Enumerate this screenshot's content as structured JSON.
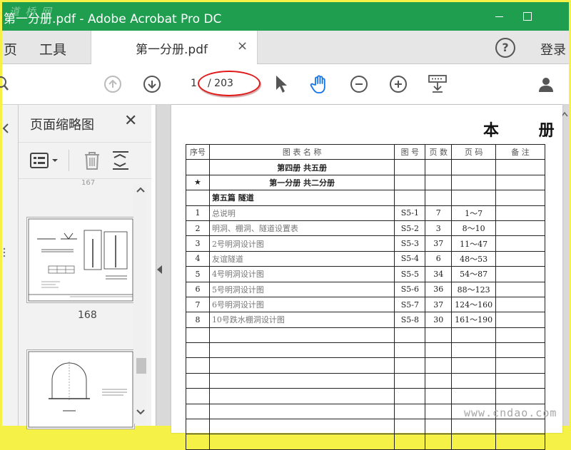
{
  "window": {
    "title": "第一分册.pdf - Adobe Acrobat Pro DC",
    "watermark": "道 桥 网"
  },
  "tabs": {
    "home_label": "页",
    "tools_label": "工具",
    "doc_tab_label": "第一分册.pdf",
    "close_glyph": "×",
    "help_glyph": "?",
    "login_label": "登录"
  },
  "toolbar": {
    "current_page": "1",
    "total_pages": "/ 203"
  },
  "thumbnails": {
    "panel_title": "页面缩略图",
    "close_glyph": "✕",
    "items": [
      {
        "page": "167"
      },
      {
        "page": "168"
      }
    ]
  },
  "document": {
    "title": "本 册",
    "headers": [
      "序号",
      "图 表 名 称",
      "图 号",
      "页 数",
      "页 码",
      "备 注"
    ],
    "rows": [
      {
        "no": "",
        "name": "第四册 共五册",
        "code": "",
        "pages": "",
        "range": ""
      },
      {
        "no": "★",
        "name": "第一分册 共二分册",
        "code": "",
        "pages": "",
        "range": ""
      },
      {
        "no": "",
        "name": "第五篇 隧道",
        "code": "",
        "pages": "",
        "range": ""
      },
      {
        "no": "1",
        "name": "总说明",
        "code": "S5-1",
        "pages": "7",
        "range": "1～7"
      },
      {
        "no": "2",
        "name": "明洞、棚洞、隧道设置表",
        "code": "S5-2",
        "pages": "3",
        "range": "8～10"
      },
      {
        "no": "3",
        "name": "2号明洞设计图",
        "code": "S5-3",
        "pages": "37",
        "range": "11～47"
      },
      {
        "no": "4",
        "name": "友谊隧道",
        "code": "S5-4",
        "pages": "6",
        "range": "48～53"
      },
      {
        "no": "5",
        "name": "4号明洞设计图",
        "code": "S5-5",
        "pages": "34",
        "range": "54～87"
      },
      {
        "no": "6",
        "name": "5号明洞设计图",
        "code": "S5-6",
        "pages": "36",
        "range": "88～123"
      },
      {
        "no": "7",
        "name": "6号明洞设计图",
        "code": "S5-7",
        "pages": "37",
        "range": "124～160"
      },
      {
        "no": "8",
        "name": "10号跌水棚洞设计图",
        "code": "S5-8",
        "pages": "30",
        "range": "161～190"
      }
    ],
    "site_mark": "www.cndao.com"
  },
  "colors": {
    "title_bar": "#1f9e4f",
    "outer_frame": "#f5f146",
    "highlight_ring": "#e01818",
    "hand_tool_active": "#1473e6"
  }
}
